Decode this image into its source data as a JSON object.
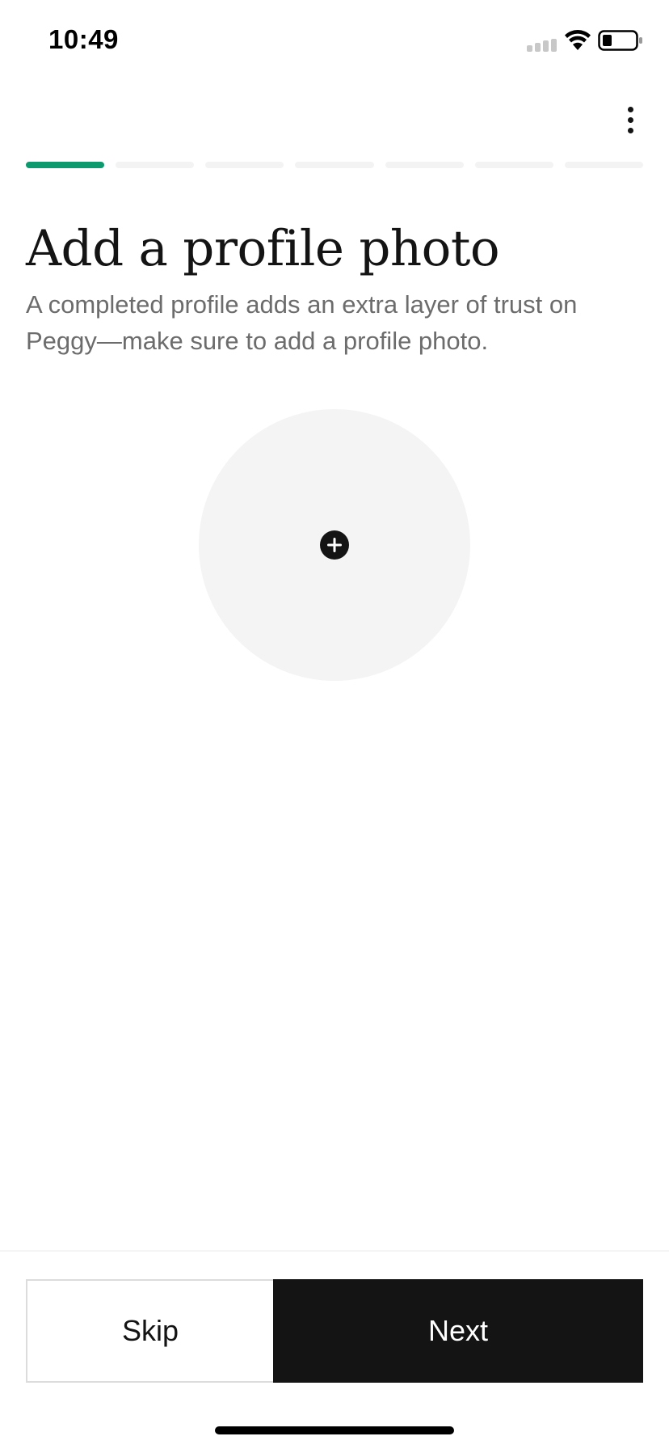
{
  "status_bar": {
    "time": "10:49",
    "icons": [
      "signal-icon",
      "wifi-icon",
      "battery-icon"
    ]
  },
  "header": {
    "menu_icon": "more-vertical-icon"
  },
  "progress": {
    "total_steps": 7,
    "current_step": 1,
    "active_color": "#0e9a6f",
    "inactive_color": "#f3f3f3"
  },
  "content": {
    "title": "Add a profile photo",
    "subtitle": "A completed profile adds an extra layer of trust on Peggy—make sure to add a profile photo.",
    "photo_picker_icon": "add-circle-icon"
  },
  "actions": {
    "skip_label": "Skip",
    "next_label": "Next",
    "next_background": "#141414"
  }
}
